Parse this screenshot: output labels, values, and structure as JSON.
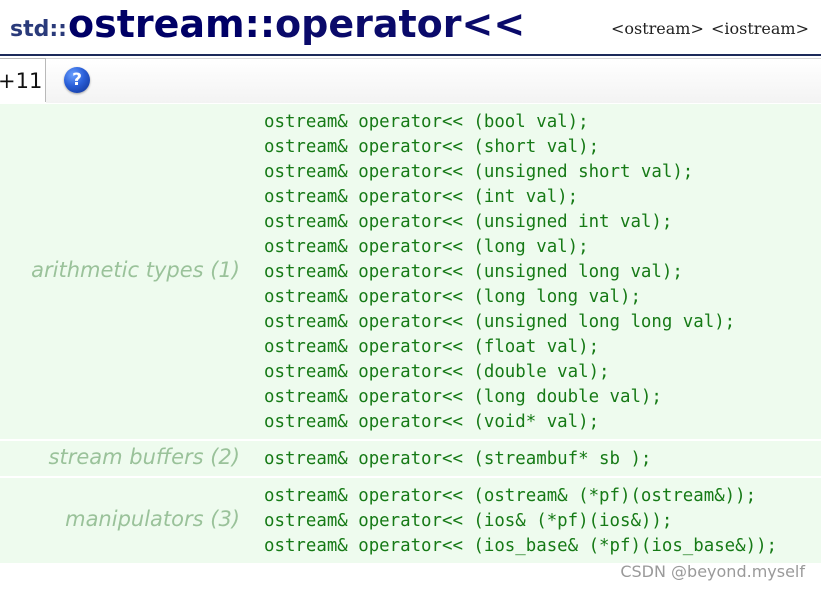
{
  "title": {
    "namespace": "std::",
    "class_name": "ostream",
    "separator": "::",
    "function_name": "operator<<",
    "headers": "<ostream> <iostream>"
  },
  "tabs": {
    "standard_label": "+11",
    "help_icon": "help-icon",
    "help_glyph": "?"
  },
  "groups": [
    {
      "label": "arithmetic types (1)",
      "lines": [
        "ostream& operator<< (bool val);",
        "ostream& operator<< (short val);",
        "ostream& operator<< (unsigned short val);",
        "ostream& operator<< (int val);",
        "ostream& operator<< (unsigned int val);",
        "ostream& operator<< (long val);",
        "ostream& operator<< (unsigned long val);",
        "ostream& operator<< (long long val);",
        "ostream& operator<< (unsigned long long val);",
        "ostream& operator<< (float val);",
        "ostream& operator<< (double val);",
        "ostream& operator<< (long double val);",
        "ostream& operator<< (void* val);"
      ]
    },
    {
      "label": "stream buffers (2)",
      "lines": [
        "ostream& operator<< (streambuf* sb );"
      ]
    },
    {
      "label": "manipulators (3)",
      "lines": [
        "ostream& operator<< (ostream& (*pf)(ostream&));",
        "ostream& operator<< (ios& (*pf)(ios&));",
        "ostream& operator<< (ios_base& (*pf)(ios_base&));"
      ]
    }
  ],
  "watermark": "CSDN @beyond.myself",
  "colors": {
    "title": "#000066",
    "code": "#167a16",
    "label": "#9ac29a",
    "row_bg": "#eefbee"
  }
}
